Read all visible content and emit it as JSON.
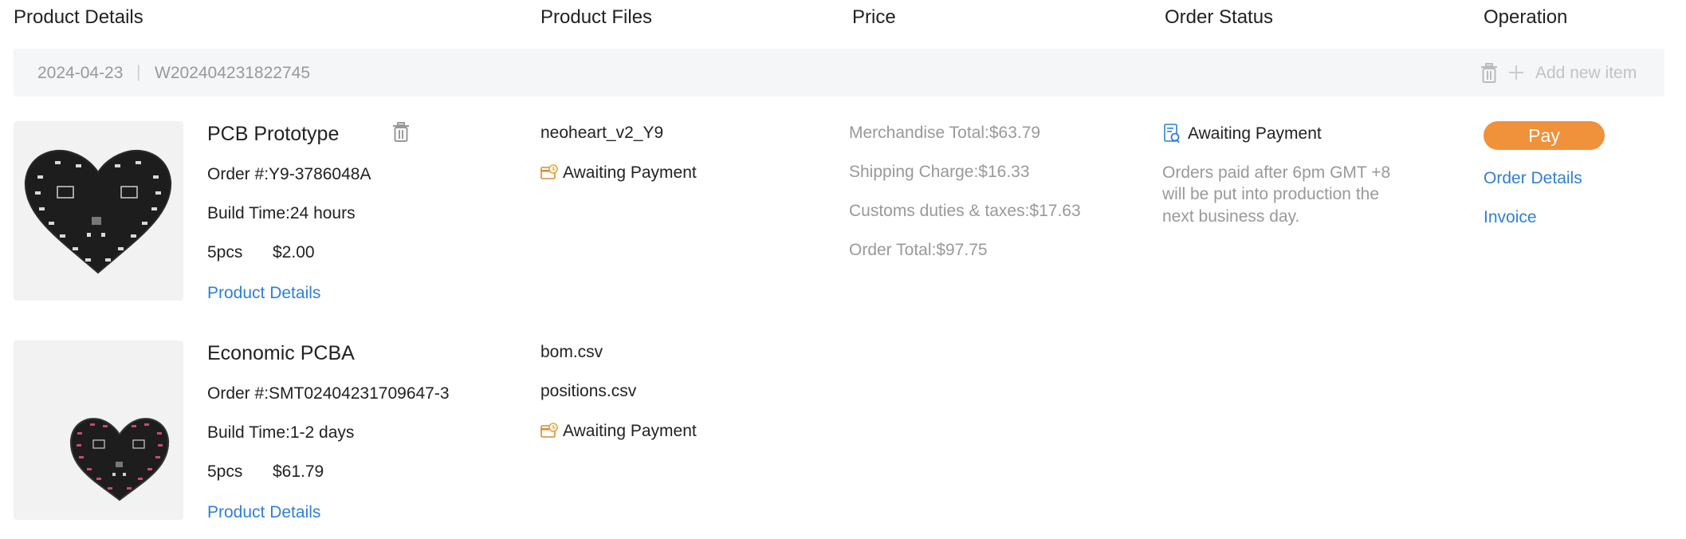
{
  "columns": [
    "Product Details",
    "Product Files",
    "Price",
    "Order Status",
    "Operation"
  ],
  "group": {
    "date": "2024-04-23",
    "separator": "|",
    "order_no": "W202404231822745",
    "add_new_item": "Add new item"
  },
  "items": [
    {
      "title": "PCB Prototype",
      "order": "Order #:Y9-3786048A",
      "build_time": "Build Time:24 hours",
      "qty": "5pcs",
      "price": "$2.00",
      "product_details_link": "Product Details",
      "files": [
        "neoheart_v2_Y9"
      ],
      "file_status": "Awaiting Payment",
      "pricing": {
        "merchandise": "Merchandise Total:$63.79",
        "shipping": "Shipping Charge:$16.33",
        "customs": "Customs duties & taxes:$17.63",
        "total": "Order Total:$97.75"
      },
      "status": "Awaiting Payment",
      "status_note": [
        "Orders paid after 6pm GMT +8",
        "will be put into production the",
        "next business day."
      ],
      "operations": {
        "pay": "Pay",
        "order_details": "Order Details",
        "invoice": "Invoice"
      }
    },
    {
      "title": "Economic PCBA",
      "order": "Order #:SMT02404231709647-3",
      "build_time": "Build Time:1-2 days",
      "qty": "5pcs",
      "price": "$61.79",
      "product_details_link": "Product Details",
      "files": [
        "bom.csv",
        "positions.csv"
      ],
      "file_status": "Awaiting Payment"
    }
  ],
  "colors": {
    "link": "#2f7fd8",
    "pay_button": "#f0913b",
    "group_bar": "#f5f6f7",
    "muted": "#999999"
  },
  "icons": [
    "trash-icon",
    "plus-icon",
    "payment-status-icon",
    "order-search-icon"
  ]
}
